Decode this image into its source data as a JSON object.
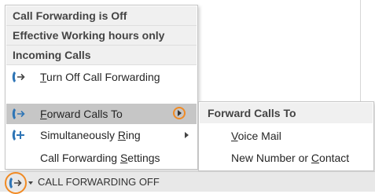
{
  "menu": {
    "headers": {
      "status": "Call Forwarding is Off",
      "hours": "Effective Working hours only",
      "incoming": "Incoming Calls"
    },
    "items": [
      {
        "pre": "",
        "accel": "T",
        "post": "urn Off Call Forwarding"
      },
      {
        "pre": "",
        "accel": "F",
        "post": "orward Calls To"
      },
      {
        "pre": "Simultaneously ",
        "accel": "R",
        "post": "ing"
      },
      {
        "pre": "Call Forwarding ",
        "accel": "S",
        "post": "ettings"
      }
    ]
  },
  "submenu": {
    "header": "Forward Calls To",
    "items": [
      {
        "pre": "",
        "accel": "V",
        "post": "oice Mail"
      },
      {
        "pre": "New Number or ",
        "accel": "C",
        "post": "ontact"
      }
    ]
  },
  "statusbar": {
    "text": "CALL FORWARDING OFF"
  },
  "colors": {
    "highlight": "#c6c6c6",
    "accent_orange": "#f08a24",
    "icon_blue": "#2e75b6",
    "header_bg": "#f0f0f0"
  },
  "icons": {
    "turn_off": "phone-forward-icon",
    "forward": "phone-forward-icon",
    "simultaneous": "phone-plus-icon",
    "status": "phone-forward-icon"
  }
}
